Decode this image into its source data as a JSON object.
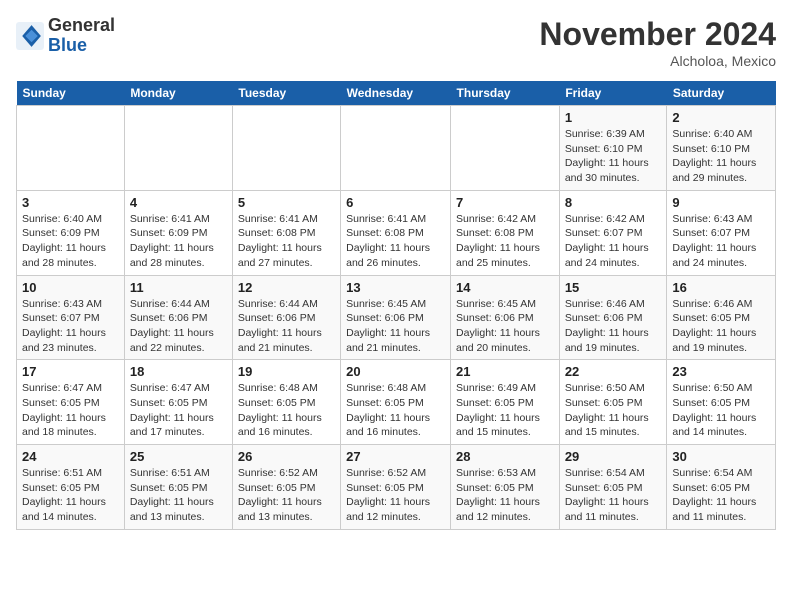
{
  "header": {
    "logo_text_general": "General",
    "logo_text_blue": "Blue",
    "month_title": "November 2024",
    "subtitle": "Alcholoa, Mexico"
  },
  "calendar": {
    "days_of_week": [
      "Sunday",
      "Monday",
      "Tuesday",
      "Wednesday",
      "Thursday",
      "Friday",
      "Saturday"
    ],
    "weeks": [
      [
        {
          "day": "",
          "info": ""
        },
        {
          "day": "",
          "info": ""
        },
        {
          "day": "",
          "info": ""
        },
        {
          "day": "",
          "info": ""
        },
        {
          "day": "",
          "info": ""
        },
        {
          "day": "1",
          "sunrise": "Sunrise: 6:39 AM",
          "sunset": "Sunset: 6:10 PM",
          "daylight": "Daylight: 11 hours and 30 minutes."
        },
        {
          "day": "2",
          "sunrise": "Sunrise: 6:40 AM",
          "sunset": "Sunset: 6:10 PM",
          "daylight": "Daylight: 11 hours and 29 minutes."
        }
      ],
      [
        {
          "day": "3",
          "sunrise": "Sunrise: 6:40 AM",
          "sunset": "Sunset: 6:09 PM",
          "daylight": "Daylight: 11 hours and 28 minutes."
        },
        {
          "day": "4",
          "sunrise": "Sunrise: 6:41 AM",
          "sunset": "Sunset: 6:09 PM",
          "daylight": "Daylight: 11 hours and 28 minutes."
        },
        {
          "day": "5",
          "sunrise": "Sunrise: 6:41 AM",
          "sunset": "Sunset: 6:08 PM",
          "daylight": "Daylight: 11 hours and 27 minutes."
        },
        {
          "day": "6",
          "sunrise": "Sunrise: 6:41 AM",
          "sunset": "Sunset: 6:08 PM",
          "daylight": "Daylight: 11 hours and 26 minutes."
        },
        {
          "day": "7",
          "sunrise": "Sunrise: 6:42 AM",
          "sunset": "Sunset: 6:08 PM",
          "daylight": "Daylight: 11 hours and 25 minutes."
        },
        {
          "day": "8",
          "sunrise": "Sunrise: 6:42 AM",
          "sunset": "Sunset: 6:07 PM",
          "daylight": "Daylight: 11 hours and 24 minutes."
        },
        {
          "day": "9",
          "sunrise": "Sunrise: 6:43 AM",
          "sunset": "Sunset: 6:07 PM",
          "daylight": "Daylight: 11 hours and 24 minutes."
        }
      ],
      [
        {
          "day": "10",
          "sunrise": "Sunrise: 6:43 AM",
          "sunset": "Sunset: 6:07 PM",
          "daylight": "Daylight: 11 hours and 23 minutes."
        },
        {
          "day": "11",
          "sunrise": "Sunrise: 6:44 AM",
          "sunset": "Sunset: 6:06 PM",
          "daylight": "Daylight: 11 hours and 22 minutes."
        },
        {
          "day": "12",
          "sunrise": "Sunrise: 6:44 AM",
          "sunset": "Sunset: 6:06 PM",
          "daylight": "Daylight: 11 hours and 21 minutes."
        },
        {
          "day": "13",
          "sunrise": "Sunrise: 6:45 AM",
          "sunset": "Sunset: 6:06 PM",
          "daylight": "Daylight: 11 hours and 21 minutes."
        },
        {
          "day": "14",
          "sunrise": "Sunrise: 6:45 AM",
          "sunset": "Sunset: 6:06 PM",
          "daylight": "Daylight: 11 hours and 20 minutes."
        },
        {
          "day": "15",
          "sunrise": "Sunrise: 6:46 AM",
          "sunset": "Sunset: 6:06 PM",
          "daylight": "Daylight: 11 hours and 19 minutes."
        },
        {
          "day": "16",
          "sunrise": "Sunrise: 6:46 AM",
          "sunset": "Sunset: 6:05 PM",
          "daylight": "Daylight: 11 hours and 19 minutes."
        }
      ],
      [
        {
          "day": "17",
          "sunrise": "Sunrise: 6:47 AM",
          "sunset": "Sunset: 6:05 PM",
          "daylight": "Daylight: 11 hours and 18 minutes."
        },
        {
          "day": "18",
          "sunrise": "Sunrise: 6:47 AM",
          "sunset": "Sunset: 6:05 PM",
          "daylight": "Daylight: 11 hours and 17 minutes."
        },
        {
          "day": "19",
          "sunrise": "Sunrise: 6:48 AM",
          "sunset": "Sunset: 6:05 PM",
          "daylight": "Daylight: 11 hours and 16 minutes."
        },
        {
          "day": "20",
          "sunrise": "Sunrise: 6:48 AM",
          "sunset": "Sunset: 6:05 PM",
          "daylight": "Daylight: 11 hours and 16 minutes."
        },
        {
          "day": "21",
          "sunrise": "Sunrise: 6:49 AM",
          "sunset": "Sunset: 6:05 PM",
          "daylight": "Daylight: 11 hours and 15 minutes."
        },
        {
          "day": "22",
          "sunrise": "Sunrise: 6:50 AM",
          "sunset": "Sunset: 6:05 PM",
          "daylight": "Daylight: 11 hours and 15 minutes."
        },
        {
          "day": "23",
          "sunrise": "Sunrise: 6:50 AM",
          "sunset": "Sunset: 6:05 PM",
          "daylight": "Daylight: 11 hours and 14 minutes."
        }
      ],
      [
        {
          "day": "24",
          "sunrise": "Sunrise: 6:51 AM",
          "sunset": "Sunset: 6:05 PM",
          "daylight": "Daylight: 11 hours and 14 minutes."
        },
        {
          "day": "25",
          "sunrise": "Sunrise: 6:51 AM",
          "sunset": "Sunset: 6:05 PM",
          "daylight": "Daylight: 11 hours and 13 minutes."
        },
        {
          "day": "26",
          "sunrise": "Sunrise: 6:52 AM",
          "sunset": "Sunset: 6:05 PM",
          "daylight": "Daylight: 11 hours and 13 minutes."
        },
        {
          "day": "27",
          "sunrise": "Sunrise: 6:52 AM",
          "sunset": "Sunset: 6:05 PM",
          "daylight": "Daylight: 11 hours and 12 minutes."
        },
        {
          "day": "28",
          "sunrise": "Sunrise: 6:53 AM",
          "sunset": "Sunset: 6:05 PM",
          "daylight": "Daylight: 11 hours and 12 minutes."
        },
        {
          "day": "29",
          "sunrise": "Sunrise: 6:54 AM",
          "sunset": "Sunset: 6:05 PM",
          "daylight": "Daylight: 11 hours and 11 minutes."
        },
        {
          "day": "30",
          "sunrise": "Sunrise: 6:54 AM",
          "sunset": "Sunset: 6:05 PM",
          "daylight": "Daylight: 11 hours and 11 minutes."
        }
      ]
    ]
  }
}
